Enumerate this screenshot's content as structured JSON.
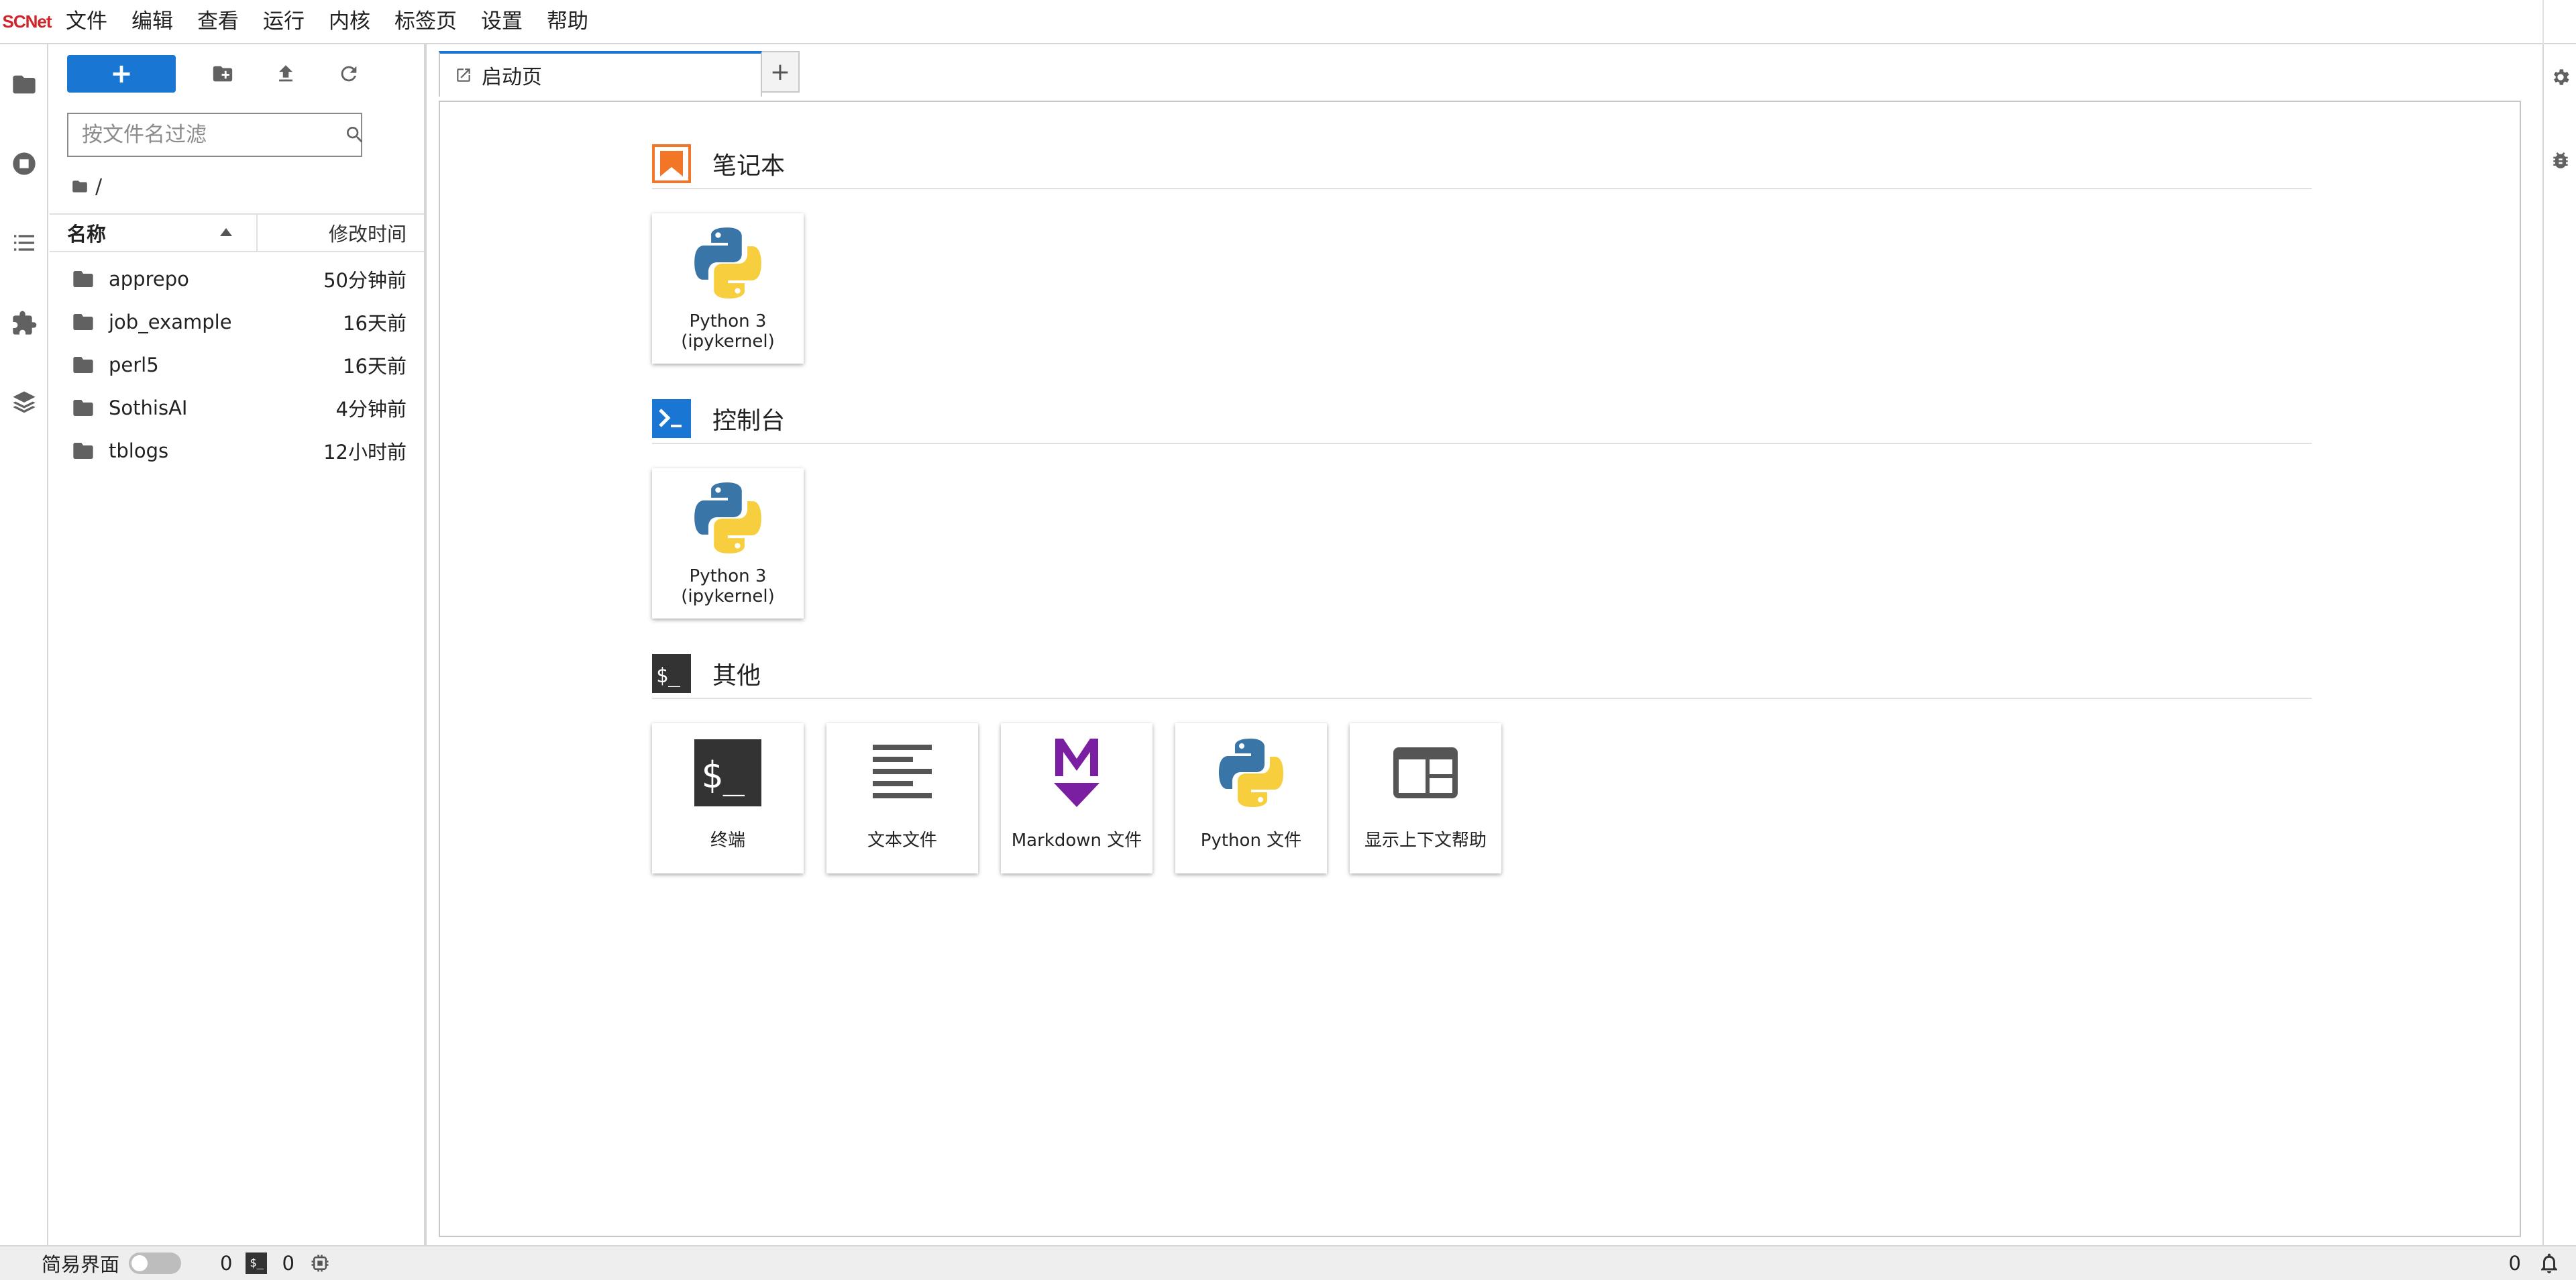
{
  "app": {
    "logo": "SCNet"
  },
  "menu": {
    "items": [
      "文件",
      "编辑",
      "查看",
      "运行",
      "内核",
      "标签页",
      "设置",
      "帮助"
    ]
  },
  "filebrowser": {
    "new_label": "+",
    "filter_placeholder": "按文件名过滤",
    "breadcrumb": "/",
    "columns": {
      "name": "名称",
      "modified": "修改时间"
    },
    "files": [
      {
        "name": "apprepo",
        "modified": "50分钟前"
      },
      {
        "name": "job_example",
        "modified": "16天前"
      },
      {
        "name": "perl5",
        "modified": "16天前"
      },
      {
        "name": "SothisAI",
        "modified": "4分钟前"
      },
      {
        "name": "tblogs",
        "modified": "12小时前"
      }
    ]
  },
  "tabs": {
    "active": "启动页",
    "add": "+"
  },
  "launcher": {
    "notebook": {
      "title": "笔记本",
      "cards": [
        {
          "line1": "Python 3",
          "line2": "(ipykernel)"
        }
      ]
    },
    "console": {
      "title": "控制台",
      "cards": [
        {
          "line1": "Python 3",
          "line2": "(ipykernel)"
        }
      ]
    },
    "other": {
      "title": "其他",
      "cards": [
        {
          "label": "终端"
        },
        {
          "label": "文本文件"
        },
        {
          "label": "Markdown 文件"
        },
        {
          "label": "Python 文件"
        },
        {
          "label": "显示上下文帮助"
        }
      ]
    }
  },
  "statusbar": {
    "simple_mode": "简易界面",
    "kernels_count": "0",
    "terminals_count": "0",
    "terminal_icon_text": "$_",
    "notifications_count": "0"
  },
  "colors": {
    "accent": "#1976d2",
    "notebook_icon": "#f37626",
    "console_icon": "#1976d2",
    "markdown": "#7b1fa2"
  }
}
